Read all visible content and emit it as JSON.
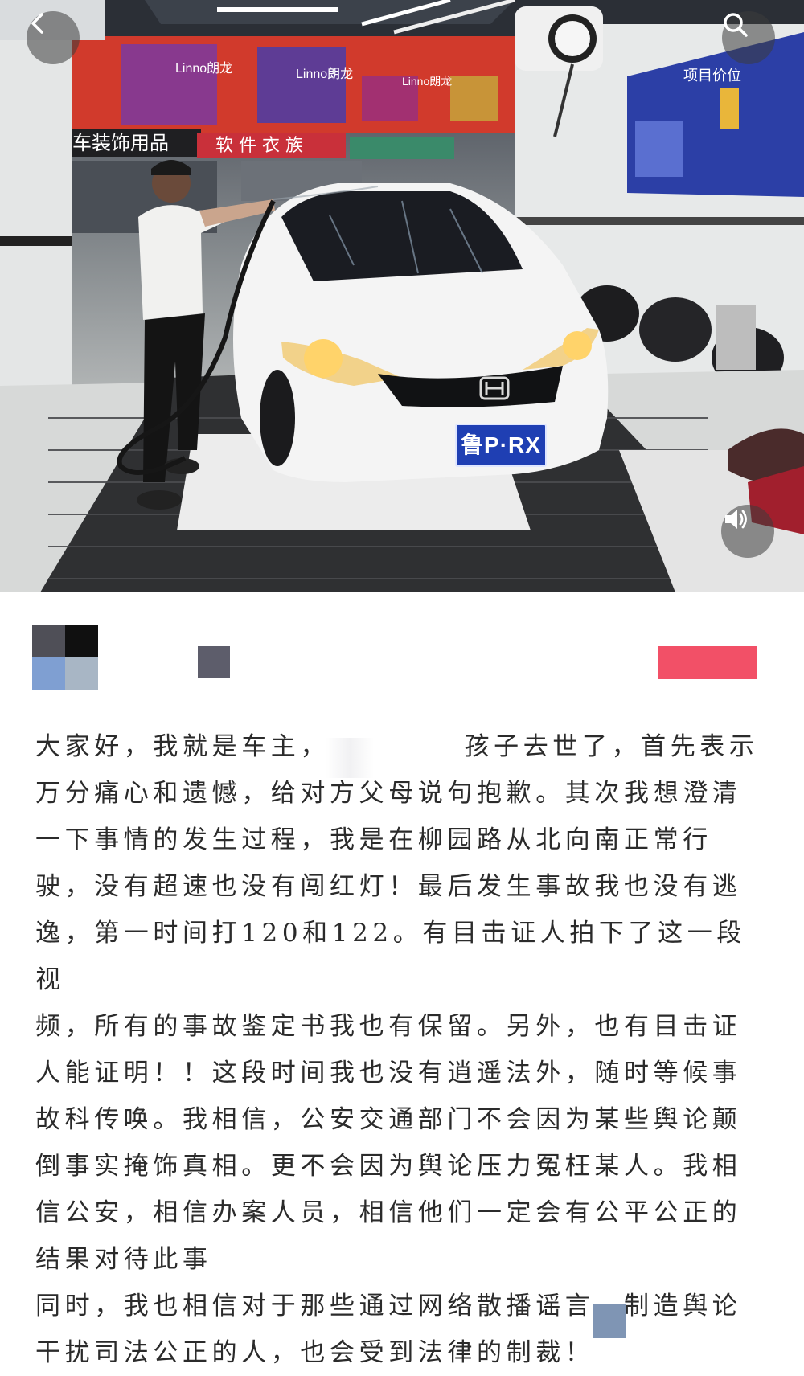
{
  "media": {
    "back_icon": "chevron-left-icon",
    "search_icon": "search-icon",
    "sound_icon": "speaker-icon",
    "shop_banner_brand": "Linno朗龙",
    "shop_sign_left": "汽车装饰用品",
    "shop_sign_mid": "软 件 衣 族",
    "price_board_title": "项目价位",
    "plate_text": "鲁P·RX",
    "car_brand_icon": "honda-logo-icon"
  },
  "author": {
    "name_redacted": true
  },
  "post": {
    "line1": "大家好，我就是车主，　　　　　孩子去世了，首先表示",
    "line2": "万分痛心和遗憾，给对方父母说句抱歉。其次我想澄清",
    "line3": "一下事情的发生过程，我是在柳园路从北向南正常行",
    "line4": "驶，没有超速也没有闯红灯！最后发生事故我也没有逃",
    "line5": "逸，第一时间打120和122。有目击证人拍下了这一段视",
    "line6": "频，所有的事故鉴定书我也有保留。另外，也有目击证",
    "line7": "人能证明！！这段时间我也没有逍遥法外，随时等候事",
    "line8": "故科传唤。我相信，公安交通部门不会因为某些舆论颠",
    "line9": "倒事实掩饰真相。更不会因为舆论压力冤枉某人。我相",
    "line10": "信公安，相信办案人员，相信他们一定会有公平公正的",
    "line11": "结果对待此事",
    "line12": "同时，我也相信对于那些通过网络散播谣言，制造舆论",
    "line13": "干扰司法公正的人，也会受到法律的制裁！"
  },
  "colors": {
    "follow_button": "#f25067",
    "text": "#2b2b2b",
    "plate_blue": "#1f3fb3"
  }
}
